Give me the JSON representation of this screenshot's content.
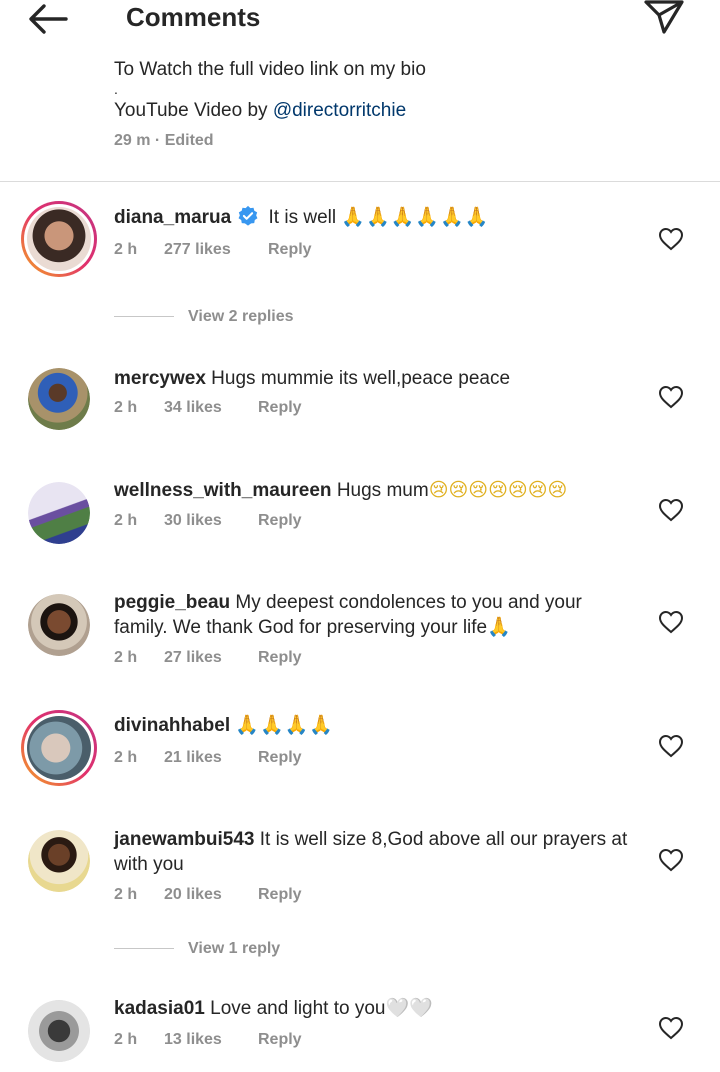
{
  "header": {
    "title": "Comments",
    "back_icon": "arrow-left-icon",
    "send_icon": "paper-plane-icon"
  },
  "caption": {
    "line1": "To Watch the full video link on my bio",
    "dot": ".",
    "line2_prefix": "YouTube Video by ",
    "line2_link": "@directorritchie",
    "meta": "29 m · Edited"
  },
  "comments": [
    {
      "username": "diana_marua",
      "verified": true,
      "text": " It is well ",
      "emoji": "🙏🙏🙏🙏🙏🙏",
      "time": "2 h",
      "likes": "277 likes",
      "reply": "Reply",
      "story": true
    },
    {
      "username": "mercywex",
      "text": " Hugs mummie its well,peace peace",
      "emoji": "",
      "time": "2 h",
      "likes": "34 likes",
      "reply": "Reply"
    },
    {
      "username": "wellness_with_maureen",
      "text": " Hugs mum",
      "emoji": "😢😢😢😢😢😢😢",
      "time": "2 h",
      "likes": "30 likes",
      "reply": "Reply"
    },
    {
      "username": "peggie_beau",
      "text": " My deepest condolences to you and your family. We thank God for preserving your life",
      "emoji": "🙏",
      "time": "2 h",
      "likes": "27 likes",
      "reply": "Reply"
    },
    {
      "username": "divinahhabel",
      "text": " ",
      "emoji": "🙏🙏🙏🙏",
      "time": "2 h",
      "likes": "21 likes",
      "reply": "Reply",
      "story": true
    },
    {
      "username": "janewambui543",
      "text": " It is well size 8,God above all our prayers at with you",
      "emoji": "",
      "time": "2 h",
      "likes": "20 likes",
      "reply": "Reply"
    },
    {
      "username": "kadasia01",
      "text": " Love and light to you",
      "emoji": "🤍🤍",
      "time": "2 h",
      "likes": "13 likes",
      "reply": "Reply"
    }
  ],
  "view_replies": {
    "first": "View 2 replies",
    "second": "View 1 reply"
  },
  "colors": {
    "text": "#262626",
    "muted": "#8e8e8e",
    "link": "#00376b",
    "verified": "#3897f0",
    "divider": "#dbdbdb"
  }
}
